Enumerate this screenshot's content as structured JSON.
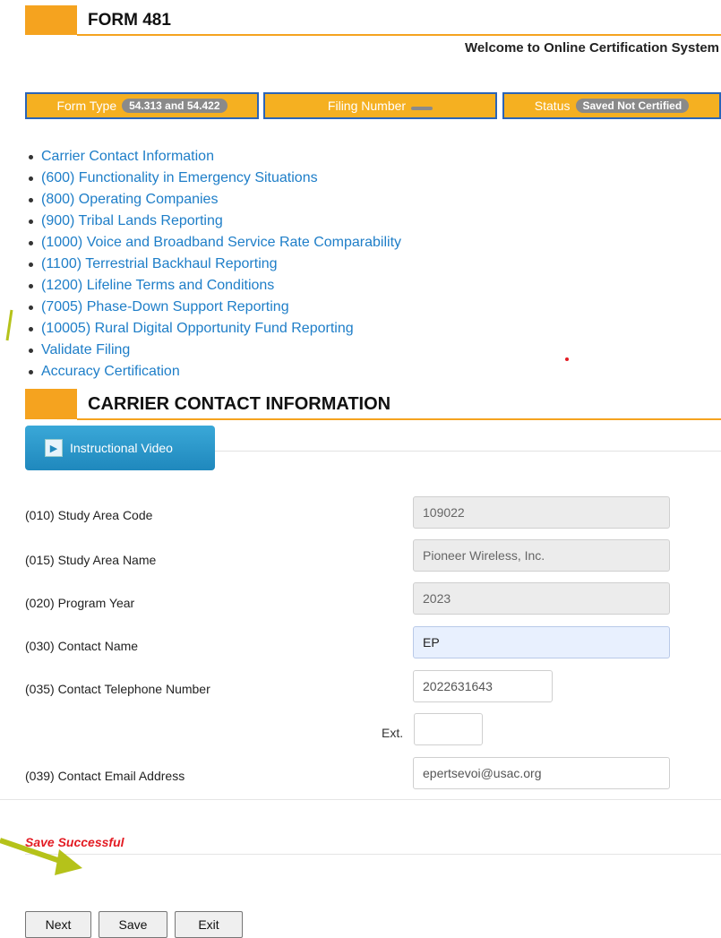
{
  "header": {
    "form_title": "FORM 481",
    "welcome": "Welcome to Online Certification System"
  },
  "status_strip": {
    "form_type_label": "Form Type",
    "form_type_value": "54.313 and 54.422",
    "filing_number_label": "Filing Number",
    "filing_number_value": "",
    "status_label": "Status",
    "status_value": "Saved Not Certified"
  },
  "nav": {
    "items": [
      {
        "label": "Carrier Contact Information"
      },
      {
        "label": "(600) Functionality in Emergency Situations"
      },
      {
        "label": "(800) Operating Companies"
      },
      {
        "label": "(900) Tribal Lands Reporting"
      },
      {
        "label": "(1000) Voice and Broadband Service Rate Comparability"
      },
      {
        "label": "(1100) Terrestrial Backhaul Reporting"
      },
      {
        "label": "(1200) Lifeline Terms and Conditions"
      },
      {
        "label": "(7005) Phase-Down Support Reporting"
      },
      {
        "label": "(10005) Rural Digital Opportunity Fund Reporting"
      },
      {
        "label": "Validate Filing"
      },
      {
        "label": "Accuracy Certification"
      }
    ]
  },
  "section": {
    "title": "CARRIER CONTACT INFORMATION",
    "video_button": "Instructional Video"
  },
  "form": {
    "study_area_code": {
      "label": "(010) Study Area Code",
      "value": "109022"
    },
    "study_area_name": {
      "label": "(015) Study Area Name",
      "value": "Pioneer Wireless, Inc."
    },
    "program_year": {
      "label": "(020) Program Year",
      "value": "2023"
    },
    "contact_name": {
      "label": "(030) Contact Name",
      "value": "EP"
    },
    "contact_phone": {
      "label": "(035) Contact Telephone Number",
      "value": "2022631643"
    },
    "ext": {
      "label": "Ext.",
      "value": ""
    },
    "contact_email": {
      "label": "(039) Contact Email Address",
      "value": "epertsevoi@usac.org"
    }
  },
  "messages": {
    "save_status": "Save Successful"
  },
  "buttons": {
    "next": "Next",
    "save": "Save",
    "exit": "Exit"
  },
  "colors": {
    "accent_orange": "#f5a31f",
    "link_blue": "#1e7ec8",
    "annotation_arrow": "#b5c21a",
    "error_red": "#e31b23"
  }
}
